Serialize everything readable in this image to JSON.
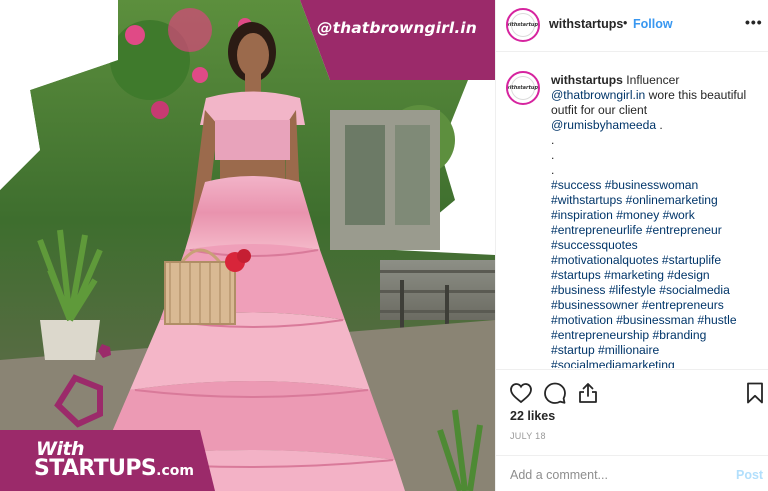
{
  "post": {
    "handle_overlay": "@thatbrowngirl.in",
    "brand_with": "With",
    "brand_startups": "STARTUPS",
    "brand_com": ".com",
    "avatar_mark": "withstartups"
  },
  "header": {
    "username": "withstartups",
    "separator": "•",
    "follow_label": "Follow",
    "more_label": "•••"
  },
  "caption": {
    "username": "withstartups",
    "intro": "Influencer",
    "mention_creator": "@thatbrowngirl.in",
    "text_1": "wore this beautiful",
    "text_2": "outfit for our client",
    "mention_client": "@rumisbyhameeda",
    "text_3": ".",
    "dot_1": ".",
    "dot_2": ".",
    "dot_3": ".",
    "hashtag_lines": [
      "#success #businesswoman",
      "#withstartups #onlinemarketing",
      "#inspiration #money #work",
      "#entrepreneurlife #entrepreneur",
      "#successquotes",
      "#motivationalquotes #startuplife",
      "#startups #marketing #design",
      "#business #lifestyle #socialmedia",
      "#businessowner #entrepreneurs",
      "#motivation #businessman #hustle",
      "#entrepreneurship #branding",
      "#startup #millionaire",
      "#socialmediamarketing"
    ]
  },
  "actions": {
    "likes": "22 likes",
    "date": "JULY 18",
    "comment_placeholder": "Add a comment...",
    "post_label": "Post"
  },
  "colors": {
    "accent_blue": "#3897f0",
    "hashtag": "#003569",
    "magenta_brand": "#9b2a6a",
    "post_disabled": "#b2dffc"
  },
  "icons": [
    "more-icon",
    "heart-icon",
    "comment-icon",
    "share-icon",
    "bookmark-icon"
  ]
}
